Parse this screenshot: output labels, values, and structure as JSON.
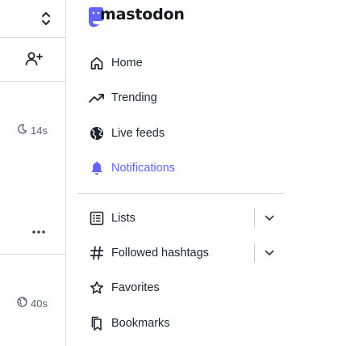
{
  "feed": {
    "column_header_icon": "chevron-up-down-icon",
    "follow_icon": "person-add-icon",
    "posts": [
      {
        "time": "14s",
        "visibility_icon": "moon-icon",
        "more_icon": "ellipsis-icon"
      },
      {
        "time": "40s",
        "visibility_icon": "globe-icon"
      }
    ]
  },
  "nav": {
    "logo_text": "mastodon",
    "brand_color": "#6364ff",
    "items": [
      {
        "label": "Home",
        "icon": "home-icon"
      },
      {
        "label": "Trending",
        "icon": "trending-icon"
      },
      {
        "label": "Live feeds",
        "icon": "globe-icon"
      },
      {
        "label": "Notifications",
        "icon": "bell-icon",
        "active": true
      },
      {
        "label": "Lists",
        "icon": "list-icon",
        "expandable": true
      },
      {
        "label": "Followed hashtags",
        "icon": "hashtag-icon",
        "expandable": true
      },
      {
        "label": "Favorites",
        "icon": "star-icon"
      },
      {
        "label": "Bookmarks",
        "icon": "bookmark-icon"
      }
    ]
  }
}
